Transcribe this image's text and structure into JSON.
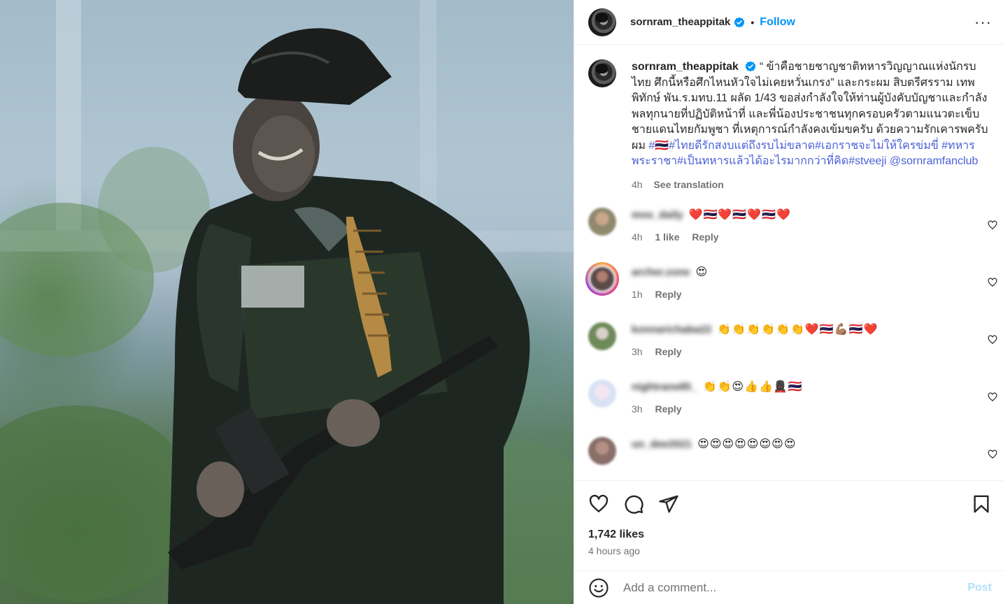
{
  "post": {
    "username": "sornram_theappitak",
    "follow_label": "Follow",
    "separator": "•",
    "more_label": "···"
  },
  "caption": {
    "username": "sornram_theappitak",
    "text": "“ ข้าคือชายชาญชาติทหารวิญญาณแห่งนักรบไทย ศึกนี้หรือศึกไหนหัวใจไม่เคยหวั่นเกรง” และกระผม สิบตรีศรราม เทพพิทักษ์ พัน.ร.มทบ.11 ผลัด 1/43 ขอส่งกำลังใจให้ท่านผู้บังคับบัญชาและกำลังพลทุกนายที่ปฏิบัติหน้าที่ และพี่น้องประชาชนทุกครอบครัวตามแนวตะเข็บชายแดนไทยกัมพูชา ที่เหตุการณ์กำลังคงเข้มขครับ ด้วยความรักเคารพครับผม ",
    "tags": "#🇹🇭#ไทยดีรักสงบแต่ถึงรบไม่ขลาด#เอกราชจะไม่ให้ใครข่มขี่ #ทหารพระราชา#เป็นทหารแล้วได้อะไรมากกว่าที่คิด#stveeji @sornramfanclub",
    "time": "4h",
    "see_translation": "See translation"
  },
  "comments": [
    {
      "user": "mos_daily",
      "text": "❤️🇹🇭❤️🇹🇭❤️🇹🇭❤️",
      "time": "4h",
      "likes": "1 like",
      "reply": "Reply"
    },
    {
      "user": "archer.zone",
      "text": "😍",
      "time": "1h",
      "likes": "",
      "reply": "Reply"
    },
    {
      "user": "konnarichaba22",
      "text": "👏👏👏👏👏👏❤️🇹🇭💪🏽🇹🇭❤️",
      "time": "3h",
      "likes": "",
      "reply": "Reply"
    },
    {
      "user": "nightrane85_",
      "text": "👏👏😍👍👍💂🏿‍♀️🇹🇭",
      "time": "3h",
      "likes": "",
      "reply": "Reply"
    },
    {
      "user": "un_dee2021",
      "text": "😍😍😍😍😍😍😍😍",
      "time": "",
      "likes": "",
      "reply": ""
    }
  ],
  "stats": {
    "likes": "1,742 likes",
    "time_ago": "4 hours ago"
  },
  "composer": {
    "placeholder": "Add a comment...",
    "post_label": "Post"
  },
  "colors": {
    "link": "#0095f6",
    "hashtag": "#4a5fd6",
    "secondary_text": "#737373",
    "post_disabled": "#b2dffc",
    "heart_red": "#ed4956"
  }
}
